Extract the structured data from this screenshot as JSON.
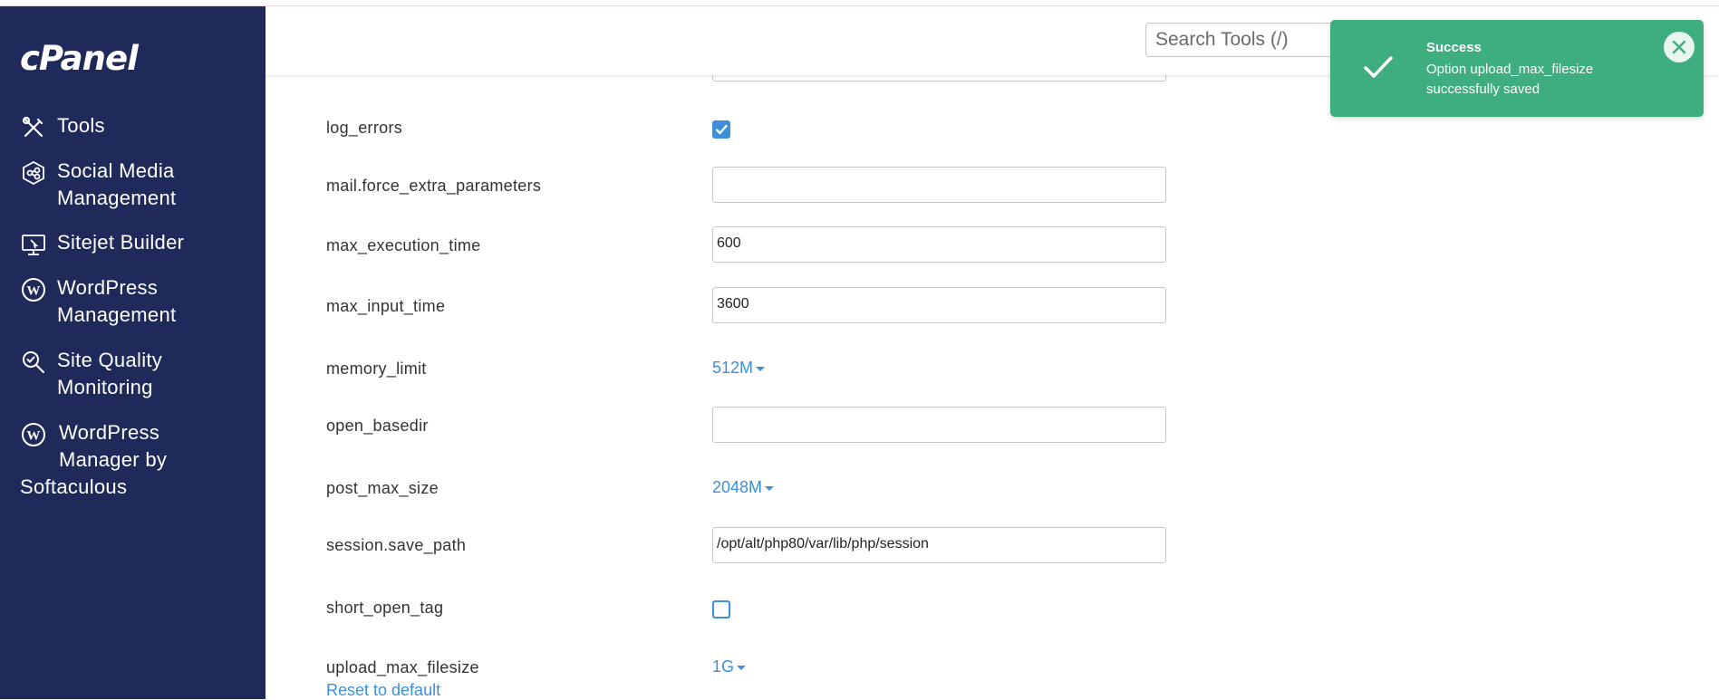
{
  "sidebar": {
    "logo": "cPanel",
    "items": [
      {
        "label": "Tools",
        "icon": "tools-icon"
      },
      {
        "label_line1": "Social Media",
        "label_line2": "Management",
        "icon": "social-media-icon"
      },
      {
        "label": "Sitejet Builder",
        "icon": "sitejet-monitor-icon"
      },
      {
        "label_line1": "WordPress",
        "label_line2": "Management",
        "icon": "wordpress-icon"
      },
      {
        "label_line1": "Site Quality",
        "label_line2": "Monitoring",
        "icon": "site-quality-search-icon"
      },
      {
        "label_line1": "WordPress",
        "label_line2": "Manager by",
        "label_line3": "Softaculous",
        "icon": "wordpress-icon"
      }
    ]
  },
  "header": {
    "search_placeholder": "Search Tools (/)"
  },
  "settings": {
    "log_errors": {
      "label": "log_errors",
      "checked": true
    },
    "mail_force_extra_parameters": {
      "label": "mail.force_extra_parameters",
      "value": ""
    },
    "max_execution_time": {
      "label": "max_execution_time",
      "value": "600"
    },
    "max_input_time": {
      "label": "max_input_time",
      "value": "3600"
    },
    "memory_limit": {
      "label": "memory_limit",
      "value": "512M"
    },
    "open_basedir": {
      "label": "open_basedir",
      "value": ""
    },
    "post_max_size": {
      "label": "post_max_size",
      "value": "2048M"
    },
    "session_save_path": {
      "label": "session.save_path",
      "value": "/opt/alt/php80/var/lib/php/session"
    },
    "short_open_tag": {
      "label": "short_open_tag",
      "checked": false
    },
    "upload_max_filesize": {
      "label": "upload_max_filesize",
      "value": "1G",
      "reset_link": "Reset to default"
    }
  },
  "toast": {
    "title": "Success",
    "message": "Option upload_max_filesize successfully saved",
    "color": "#3fae7e"
  },
  "colors": {
    "sidebar_bg": "#1f2a5a",
    "accent": "#3d8fd8"
  }
}
